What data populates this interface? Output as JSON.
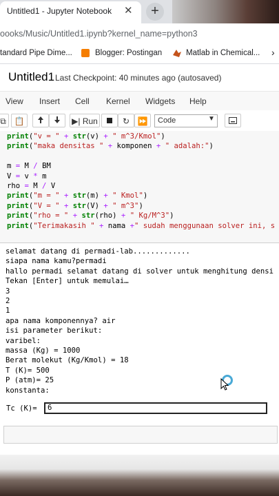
{
  "browser": {
    "tab_title": "Untitled1 - Jupyter Notebook",
    "tab_close": "✕",
    "new_tab": "+",
    "url": "oooks/Music/Untitled1.ipynb?kernel_name=python3",
    "bookmarks": [
      {
        "label": "tandard Pipe Dime...",
        "icon": "page-icon"
      },
      {
        "label": "Blogger: Postingan",
        "icon": "blogger-icon",
        "color": "#f57d00"
      },
      {
        "label": "Matlab in Chemical...",
        "icon": "matlab-icon",
        "color": "#c4531c"
      }
    ],
    "bookmarks_more": "›"
  },
  "notebook": {
    "title": "Untitled1",
    "checkpoint": "Last Checkpoint: 40 minutes ago  (autosaved)",
    "menu": [
      "View",
      "Insert",
      "Cell",
      "Kernel",
      "Widgets",
      "Help"
    ],
    "toolbar": {
      "run_label": "Run",
      "cell_type": "Code"
    }
  },
  "code_lines": [
    "print(\"v = \" + str(v) + \" m^3/Kmol\")",
    "print(\"maka densitas \" + komponen + \" adalah:\")",
    "",
    "m = M / BM",
    "V = v * m",
    "rho = M / V",
    "print(\"m = \" + str(m) + \" Kmol\")",
    "print(\"V = \" + str(V) + \" m^3\")",
    "print(\"rho = \" + str(rho) + \" Kg/M^3\")",
    "print(\"Terimakasih \" + nama +\" sudah menggunaan solver ini, s"
  ],
  "output_lines": [
    "selamat datang di permadi-lab.............",
    "siapa nama kamu?permadi",
    "hallo permadi selamat datang di solver untuk menghitung densi",
    "Tekan [Enter] untuk memulai…",
    "3",
    "2",
    "1",
    "apa nama komponennya? air",
    "isi parameter berikut:",
    "varibel:",
    "massa (Kg) = 1000",
    "Berat molekut (Kg/Kmol) = 18",
    "T (K)= 500",
    "P (atm)= 25",
    "konstanta:"
  ],
  "input_prompt": {
    "label": "Tc (K)=",
    "value": "6"
  }
}
